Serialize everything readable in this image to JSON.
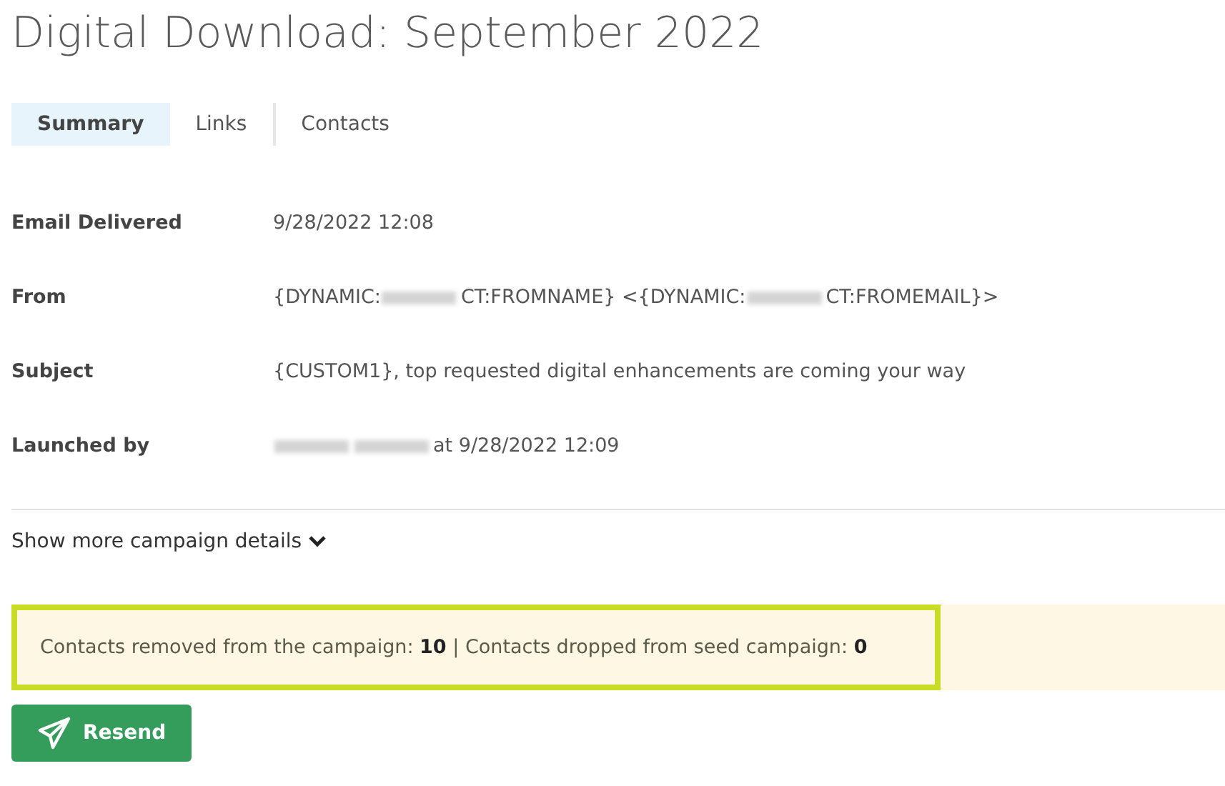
{
  "title": "Digital Download: September 2022",
  "tabs": [
    {
      "label": "Summary",
      "selected": true
    },
    {
      "label": "Links",
      "selected": false
    },
    {
      "label": "Contacts",
      "selected": false
    }
  ],
  "details": [
    {
      "label": "Email Delivered",
      "value": [
        {
          "kind": "text",
          "text": "9/28/2022 12:08"
        }
      ]
    },
    {
      "label": "From",
      "value": [
        {
          "kind": "text",
          "text": "{DYNAMIC:"
        },
        {
          "kind": "redacted"
        },
        {
          "kind": "text",
          "text": "CT:FROMNAME} <{DYNAMIC:"
        },
        {
          "kind": "redacted"
        },
        {
          "kind": "text",
          "text": "CT:FROMEMAIL}>"
        }
      ]
    },
    {
      "label": "Subject",
      "value": [
        {
          "kind": "text",
          "text": "{CUSTOM1}, top requested digital enhancements are coming your way"
        }
      ]
    },
    {
      "label": "Launched by",
      "value": [
        {
          "kind": "redacted"
        },
        {
          "kind": "redacted"
        },
        {
          "kind": "text",
          "text": "at 9/28/2022 12:09"
        }
      ]
    }
  ],
  "more_link": {
    "label": "Show more campaign details",
    "expanded": false
  },
  "notice": {
    "text": "Contacts removed from the campaign: **10** | Contacts dropped from seed campaign: **0**",
    "highlighted": true
  },
  "buttons": [
    {
      "label": "Resend"
    }
  ]
}
